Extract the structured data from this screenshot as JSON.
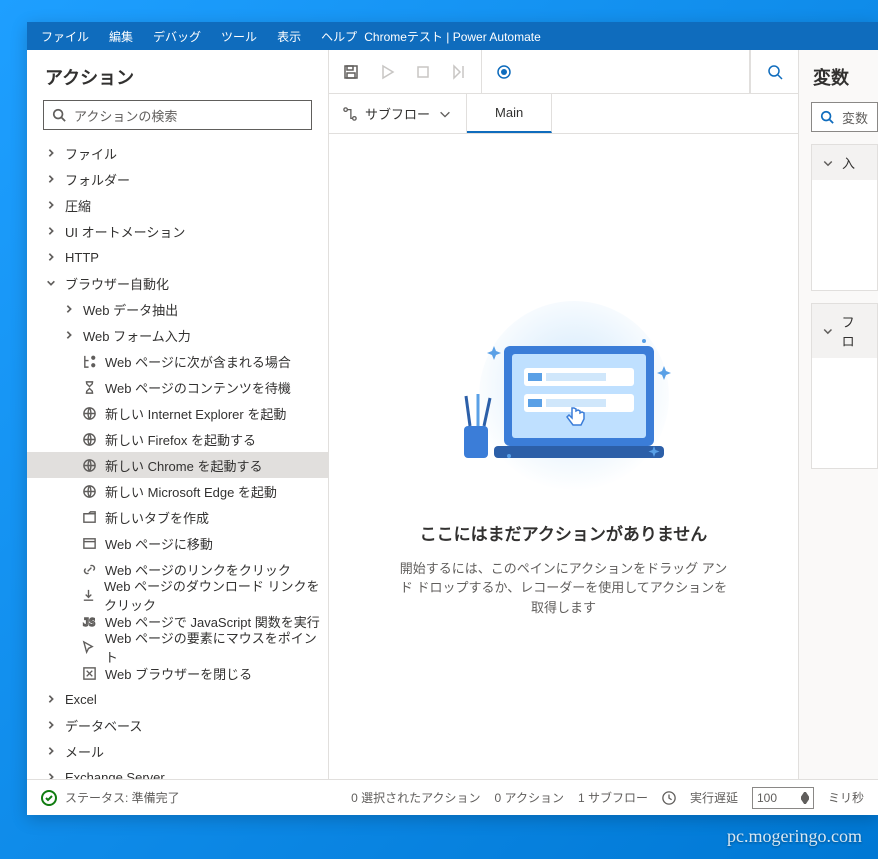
{
  "window_title": "Chromeテスト | Power Automate",
  "menus": [
    "ファイル",
    "編集",
    "デバッグ",
    "ツール",
    "表示",
    "ヘルプ"
  ],
  "sidebar": {
    "title": "アクション",
    "search_placeholder": "アクションの検索",
    "nodes": [
      {
        "label": "ファイル",
        "level": 0,
        "expandable": true,
        "expanded": false
      },
      {
        "label": "フォルダー",
        "level": 0,
        "expandable": true,
        "expanded": false
      },
      {
        "label": "圧縮",
        "level": 0,
        "expandable": true,
        "expanded": false
      },
      {
        "label": "UI オートメーション",
        "level": 0,
        "expandable": true,
        "expanded": false
      },
      {
        "label": "HTTP",
        "level": 0,
        "expandable": true,
        "expanded": false
      },
      {
        "label": "ブラウザー自動化",
        "level": 0,
        "expandable": true,
        "expanded": true
      },
      {
        "label": "Web データ抽出",
        "level": 1,
        "expandable": true,
        "expanded": false
      },
      {
        "label": "Web フォーム入力",
        "level": 1,
        "expandable": true,
        "expanded": false
      },
      {
        "label": "Web ページに次が含まれる場合",
        "level": 2,
        "icon": "branch"
      },
      {
        "label": "Web ページのコンテンツを待機",
        "level": 2,
        "icon": "hourglass"
      },
      {
        "label": "新しい Internet Explorer を起動",
        "level": 2,
        "icon": "globe"
      },
      {
        "label": "新しい Firefox を起動する",
        "level": 2,
        "icon": "globe"
      },
      {
        "label": "新しい Chrome を起動する",
        "level": 2,
        "icon": "globe",
        "selected": true
      },
      {
        "label": "新しい Microsoft Edge を起動",
        "level": 2,
        "icon": "globe"
      },
      {
        "label": "新しいタブを作成",
        "level": 2,
        "icon": "tab"
      },
      {
        "label": "Web ページに移動",
        "level": 2,
        "icon": "window"
      },
      {
        "label": "Web ページのリンクをクリック",
        "level": 2,
        "icon": "link"
      },
      {
        "label": "Web ページのダウンロード リンクをクリック",
        "level": 2,
        "icon": "download"
      },
      {
        "label": "Web ページで JavaScript 関数を実行",
        "level": 2,
        "icon": "js"
      },
      {
        "label": "Web ページの要素にマウスをポイント",
        "level": 2,
        "icon": "cursor"
      },
      {
        "label": "Web ブラウザーを閉じる",
        "level": 2,
        "icon": "close-box"
      },
      {
        "label": "Excel",
        "level": 0,
        "expandable": true,
        "expanded": false
      },
      {
        "label": "データベース",
        "level": 0,
        "expandable": true,
        "expanded": false
      },
      {
        "label": "メール",
        "level": 0,
        "expandable": true,
        "expanded": false
      },
      {
        "label": "Exchange Server",
        "level": 0,
        "expandable": true,
        "expanded": false
      }
    ]
  },
  "center": {
    "subflow_label": "サブフロー",
    "tab_main": "Main",
    "empty_title": "ここにはまだアクションがありません",
    "empty_sub": "開始するには、このペインにアクションをドラッグ アンド ドロップするか、レコーダーを使用してアクションを取得します"
  },
  "right": {
    "title": "変数",
    "search_placeholder": "変数",
    "panel1": "入",
    "panel2": "フロ"
  },
  "status": {
    "ready": "ステータス: 準備完了",
    "selected": "0 選択されたアクション",
    "actions": "0 アクション",
    "subflows": "1 サブフロー",
    "delay_label": "実行遅延",
    "delay_value": "100",
    "delay_unit": "ミリ秒"
  },
  "watermark": "pc.mogeringo.com"
}
